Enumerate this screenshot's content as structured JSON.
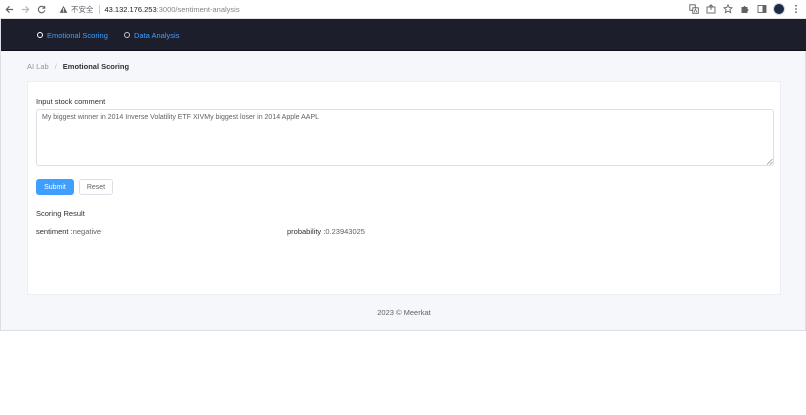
{
  "browser": {
    "security_label": "不安全",
    "url_host": "43.132.176.253",
    "url_path": ":3000/sentiment-analysis"
  },
  "nav": {
    "items": [
      {
        "label": "Emotional Scoring",
        "icon": "circle-dot-icon"
      },
      {
        "label": "Data Analysis",
        "icon": "circle-dot-icon"
      }
    ],
    "colors": {
      "background": "#1c1f2b",
      "link": "#409eff"
    }
  },
  "breadcrumb": {
    "items": [
      "AI Lab",
      "Emotional Scoring"
    ],
    "separator": "/"
  },
  "form": {
    "label": "Input stock comment",
    "value": "My biggest winner in 2014 Inverse Volatility ETF XIVMy biggest loser in 2014 Apple AAPL",
    "submit_label": "Submit",
    "reset_label": "Reset"
  },
  "result": {
    "title": "Scoring Result",
    "sentiment_key": "sentiment :",
    "sentiment_value": "negative",
    "probability_key": "probability :",
    "probability_value": "0.23943025"
  },
  "footer": {
    "text": "2023 © Meerkat"
  },
  "colors": {
    "primary": "#409eff",
    "page_bg": "#f5f7fa"
  }
}
